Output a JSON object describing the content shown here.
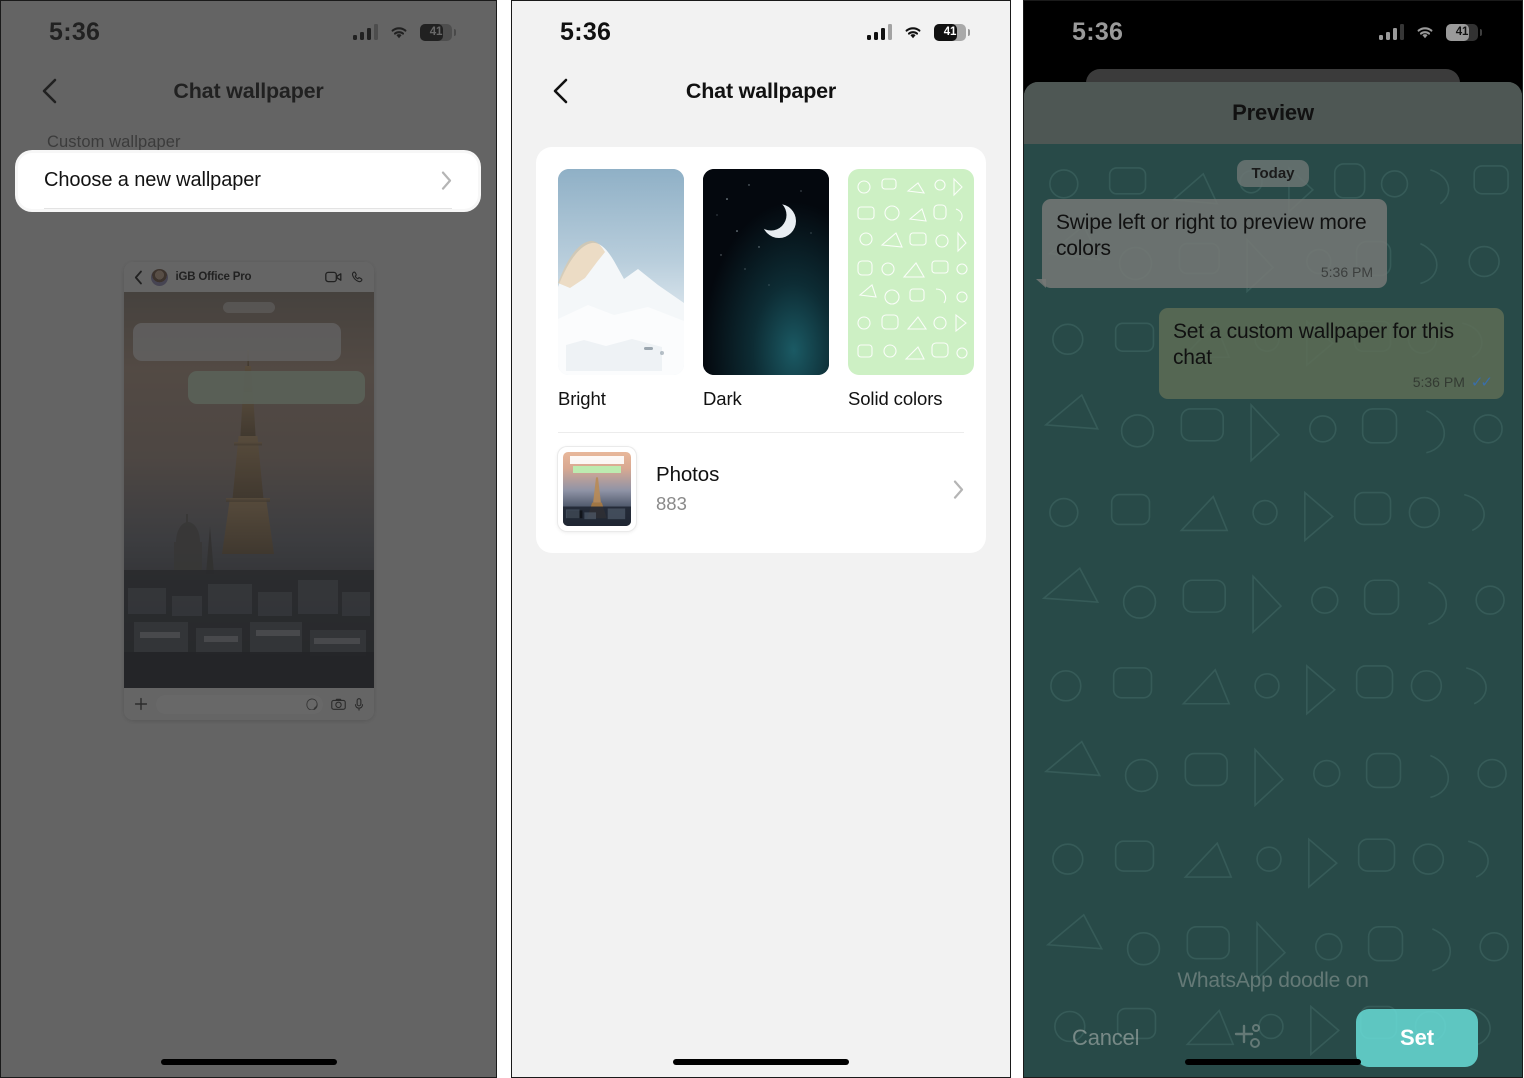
{
  "status_bar": {
    "time": "5:36",
    "battery_percent": "41",
    "signal_icon": "cellular-signal-icon",
    "wifi_icon": "wifi-icon",
    "battery_icon": "battery-icon"
  },
  "panel1": {
    "nav": {
      "title": "Chat wallpaper",
      "back_icon": "back-chevron-icon"
    },
    "section_label": "Custom wallpaper",
    "highlighted_row": {
      "label": "Choose a new wallpaper",
      "chevron_icon": "chevron-right-icon"
    },
    "chat_preview": {
      "contact_name": "iGB Office Pro",
      "back_icon": "back-chevron-icon",
      "video_icon": "video-call-icon",
      "call_icon": "voice-call-icon",
      "plus_icon": "attach-plus-icon",
      "sticker_icon": "sticker-icon",
      "camera_icon": "camera-icon",
      "mic_icon": "microphone-icon",
      "wallpaper_description": "Paris skyline with Eiffel Tower at sunset"
    }
  },
  "panel2": {
    "nav": {
      "title": "Chat wallpaper",
      "back_icon": "back-chevron-icon"
    },
    "wallpaper_options": [
      {
        "label": "Bright",
        "thumb": "snowy-mountain-thumbnail"
      },
      {
        "label": "Dark",
        "thumb": "crescent-moon-night-thumbnail"
      },
      {
        "label": "Solid colors",
        "thumb": "light-green-doodle-thumbnail"
      }
    ],
    "photos_row": {
      "title": "Photos",
      "count": "883",
      "chevron_icon": "chevron-right-icon",
      "thumb": "paris-photo-thumbnail"
    }
  },
  "panel3": {
    "sheet_title": "Preview",
    "date_badge": "Today",
    "messages": [
      {
        "direction": "incoming",
        "text": "Swipe left or right to preview more colors",
        "time": "5:36 PM",
        "ticks": ""
      },
      {
        "direction": "outgoing",
        "text": "Set a custom wallpaper for this chat",
        "time": "5:36 PM",
        "ticks": "✓✓"
      }
    ],
    "footer_label": "WhatsApp doodle on",
    "cancel_label": "Cancel",
    "sparkle_icon": "sparkle-ai-icon",
    "set_label": "Set"
  },
  "colors": {
    "chat_teal": "#284a48",
    "set_button": "#6ce5e0",
    "solid_green": "#cdf0c4",
    "outgoing_bubble": "#606e56",
    "tick_blue": "#3a6ea8"
  }
}
